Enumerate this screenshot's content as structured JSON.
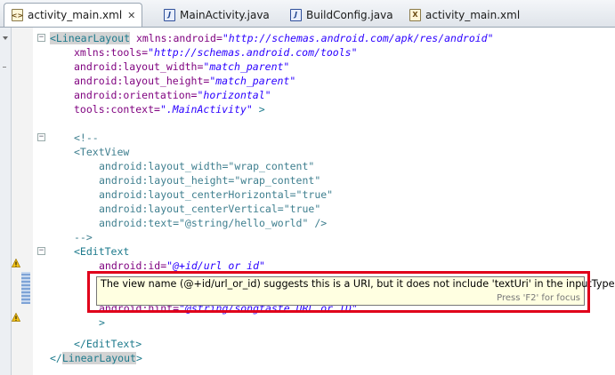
{
  "tabs": [
    {
      "label": "activity_main.xml",
      "type": "xml",
      "active": true,
      "close": "✕"
    },
    {
      "label": "MainActivity.java",
      "type": "java"
    },
    {
      "label": "BuildConfig.java",
      "type": "java"
    },
    {
      "label": "activity_main.xml",
      "type": "xml"
    }
  ],
  "code": {
    "l1": {
      "tag": "<LinearLayout",
      "attr": " xmlns:android=",
      "val": "\"http://schemas.android.com/apk/res/android\""
    },
    "l2": {
      "attr": "xmlns:tools=",
      "val": "\"http://schemas.android.com/tools\""
    },
    "l3": {
      "attr": "android:layout_width=",
      "val": "\"match_parent\""
    },
    "l4": {
      "attr": "android:layout_height=",
      "val": "\"match_parent\""
    },
    "l5": {
      "attr": "android:orientation=",
      "val": "\"horizontal\""
    },
    "l6": {
      "attr": "tools:context=",
      "val": "\".MainActivity\"",
      "close": " >"
    },
    "c1": "<!--",
    "c2": "<TextView",
    "c3": "android:layout_width=\"wrap_content\"",
    "c4": "android:layout_height=\"wrap_content\"",
    "c5": "android:layout_centerHorizontal=\"true\"",
    "c6": "android:layout_centerVertical=\"true\"",
    "c7": "android:text=\"@string/hello_world\" />",
    "c8": "-->",
    "e1": "<EditText",
    "e2": {
      "attr": "android:id=",
      "val": "\"@+id/url_or_id\""
    },
    "e3": {
      "attr": "android:hint=",
      "val": "\"@string/songtaste URL or ID\""
    },
    "e4": ">",
    "e5": "</EditText>",
    "end_open": "</",
    "end_name": "LinearLayout",
    "end_close": ">"
  },
  "tooltip": {
    "message": "The view name (@+id/url_or_id) suggests this is a URI, but it does not include 'textUri' in the inputType",
    "focus_hint": "Press 'F2' for focus"
  },
  "colors": {
    "highlight_box": "#e0001a",
    "tooltip_bg": "#ffffe1"
  }
}
